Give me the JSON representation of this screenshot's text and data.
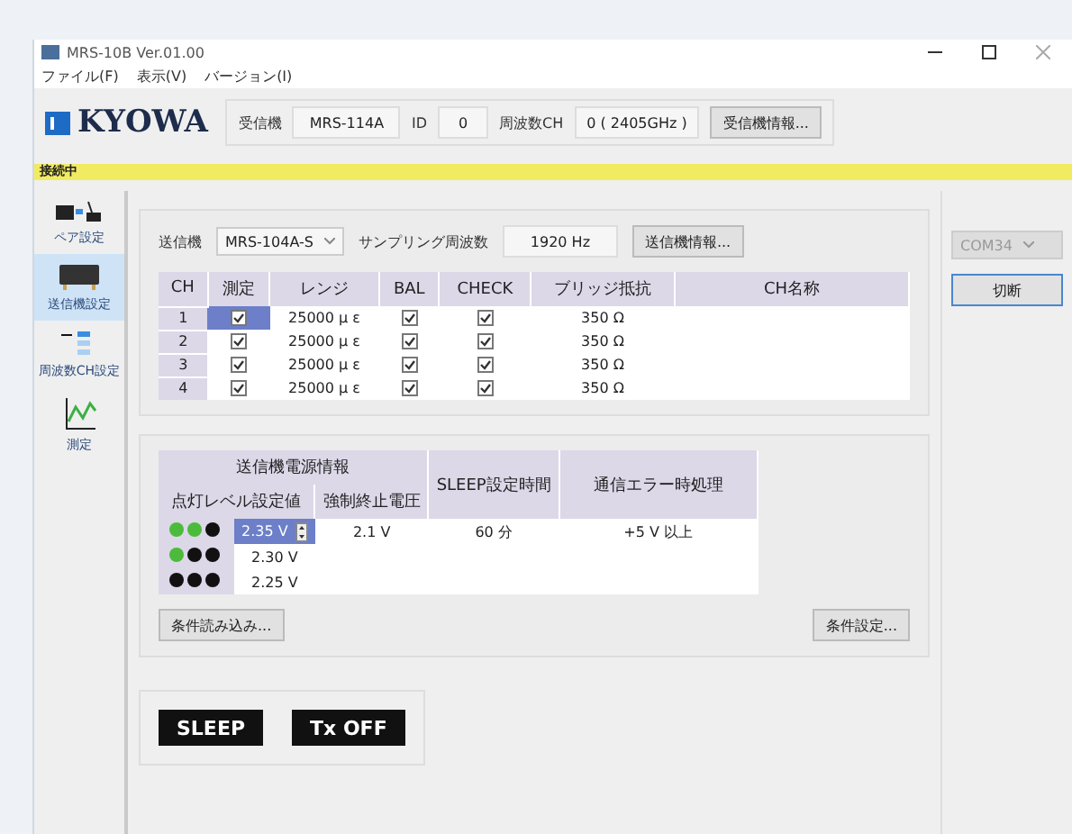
{
  "window": {
    "title": "MRS-10B Ver.01.00"
  },
  "menu": [
    "ファイル(F)",
    "表示(V)",
    "バージョン(I)"
  ],
  "header": {
    "logo": "KYOWA",
    "receiver_label": "受信機",
    "receiver": "MRS-114A",
    "id_label": "ID",
    "id": "0",
    "freq_label": "周波数CH",
    "freq": "0 ( 2405GHz )",
    "info_button": "受信機情報..."
  },
  "status": "接続中",
  "sidebar": [
    {
      "label": "ペア設定",
      "selected": false
    },
    {
      "label": "送信機設定",
      "selected": true
    },
    {
      "label": "周波数CH設定",
      "selected": false
    },
    {
      "label": "測定",
      "selected": false
    }
  ],
  "transmitter": {
    "label": "送信機",
    "value": "MRS-104A-S",
    "sampling_label": "サンプリング周波数",
    "sampling": "1920 Hz",
    "info_button": "送信機情報..."
  },
  "channels": {
    "columns": [
      "CH",
      "測定",
      "レンジ",
      "BAL",
      "CHECK",
      "ブリッジ抵抗",
      "CH名称"
    ],
    "rows": [
      {
        "ch": "1",
        "measure": true,
        "range": "25000 μ ε",
        "bal": true,
        "check": true,
        "bridge": "350 Ω",
        "selected": true
      },
      {
        "ch": "2",
        "measure": true,
        "range": "25000 μ ε",
        "bal": true,
        "check": true,
        "bridge": "350 Ω",
        "selected": false
      },
      {
        "ch": "3",
        "measure": true,
        "range": "25000 μ ε",
        "bal": true,
        "check": true,
        "bridge": "350 Ω",
        "selected": false
      },
      {
        "ch": "4",
        "measure": true,
        "range": "25000 μ ε",
        "bal": true,
        "check": true,
        "bridge": "350 Ω",
        "selected": false
      }
    ]
  },
  "power": {
    "group": "送信機電源情報",
    "columns": [
      "点灯レベル設定値",
      "強制終止電圧",
      "SLEEP設定時間",
      "通信エラー時処理"
    ],
    "rows": [
      {
        "dots": [
          {
            "color": "#4cbb3c"
          },
          {
            "color": "#4cbb3c"
          },
          {
            "color": "#111111"
          }
        ],
        "level": "2.35 V",
        "selected": true,
        "cutoff": "2.1 V",
        "sleep": "60 分",
        "error": "+5 V 以上"
      },
      {
        "dots": [
          {
            "color": "#4cbb3c"
          },
          {
            "color": "#111111"
          },
          {
            "color": "#111111"
          }
        ],
        "level": "2.30 V",
        "selected": false
      },
      {
        "dots": [
          {
            "color": "#111111"
          },
          {
            "color": "#111111"
          },
          {
            "color": "#111111"
          }
        ],
        "level": "2.25 V",
        "selected": false
      }
    ]
  },
  "load_button": "条件読み込み...",
  "set_button": "条件設定...",
  "actions": [
    "SLEEP",
    "Tx OFF"
  ],
  "port": {
    "value": "COM34",
    "disabled": true
  },
  "disconnect_button": "切断"
}
